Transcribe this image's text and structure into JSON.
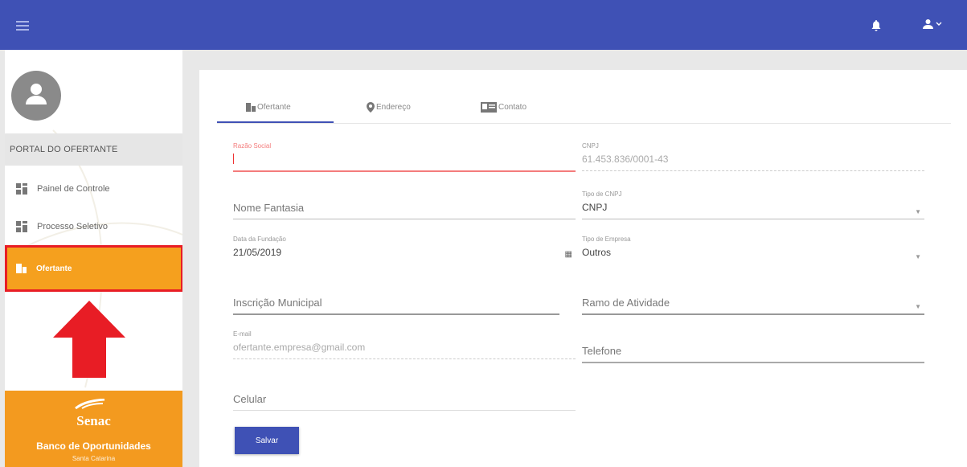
{
  "portal_title": "PORTAL DO OFERTANTE",
  "sidebar": {
    "items": [
      {
        "label": "Painel de Controle",
        "icon": "dashboard-icon"
      },
      {
        "label": "Processo Seletivo",
        "icon": "dashboard-icon"
      },
      {
        "label": "Ofertante",
        "icon": "building-icon"
      }
    ]
  },
  "brand": {
    "name": "Senac",
    "subtitle": "Banco de Oportunidades",
    "state": "Santa Catarina"
  },
  "tabs": [
    {
      "label": "Ofertante",
      "icon": "building-icon"
    },
    {
      "label": "Endereço",
      "icon": "location-pin-icon"
    },
    {
      "label": "Contato",
      "icon": "contact-card-icon"
    }
  ],
  "form": {
    "razao_social": {
      "label": "Razão Social",
      "value": ""
    },
    "cnpj": {
      "label": "CNPJ",
      "value": "61.453.836/0001-43"
    },
    "nome_fantasia": {
      "placeholder": "Nome Fantasia"
    },
    "tipo_cnpj": {
      "label": "Tipo de CNPJ",
      "value": "CNPJ"
    },
    "data_fundacao": {
      "label": "Data da Fundação",
      "value": "21/05/2019"
    },
    "tipo_empresa": {
      "label": "Tipo de Empresa",
      "value": "Outros"
    },
    "inscricao_municipal": {
      "placeholder": "Inscrição Municipal"
    },
    "ramo_atividade": {
      "placeholder": "Ramo de Atividade"
    },
    "email": {
      "label": "E-mail",
      "value": "ofertante.empresa@gmail.com"
    },
    "telefone": {
      "placeholder": "Telefone"
    },
    "celular": {
      "placeholder": "Celular"
    }
  },
  "save_label": "Salvar",
  "colors": {
    "topbar": "#3f51b5",
    "accent_orange": "#f5a01e",
    "highlight_red": "#e81d25",
    "error": "#f47c7c"
  }
}
